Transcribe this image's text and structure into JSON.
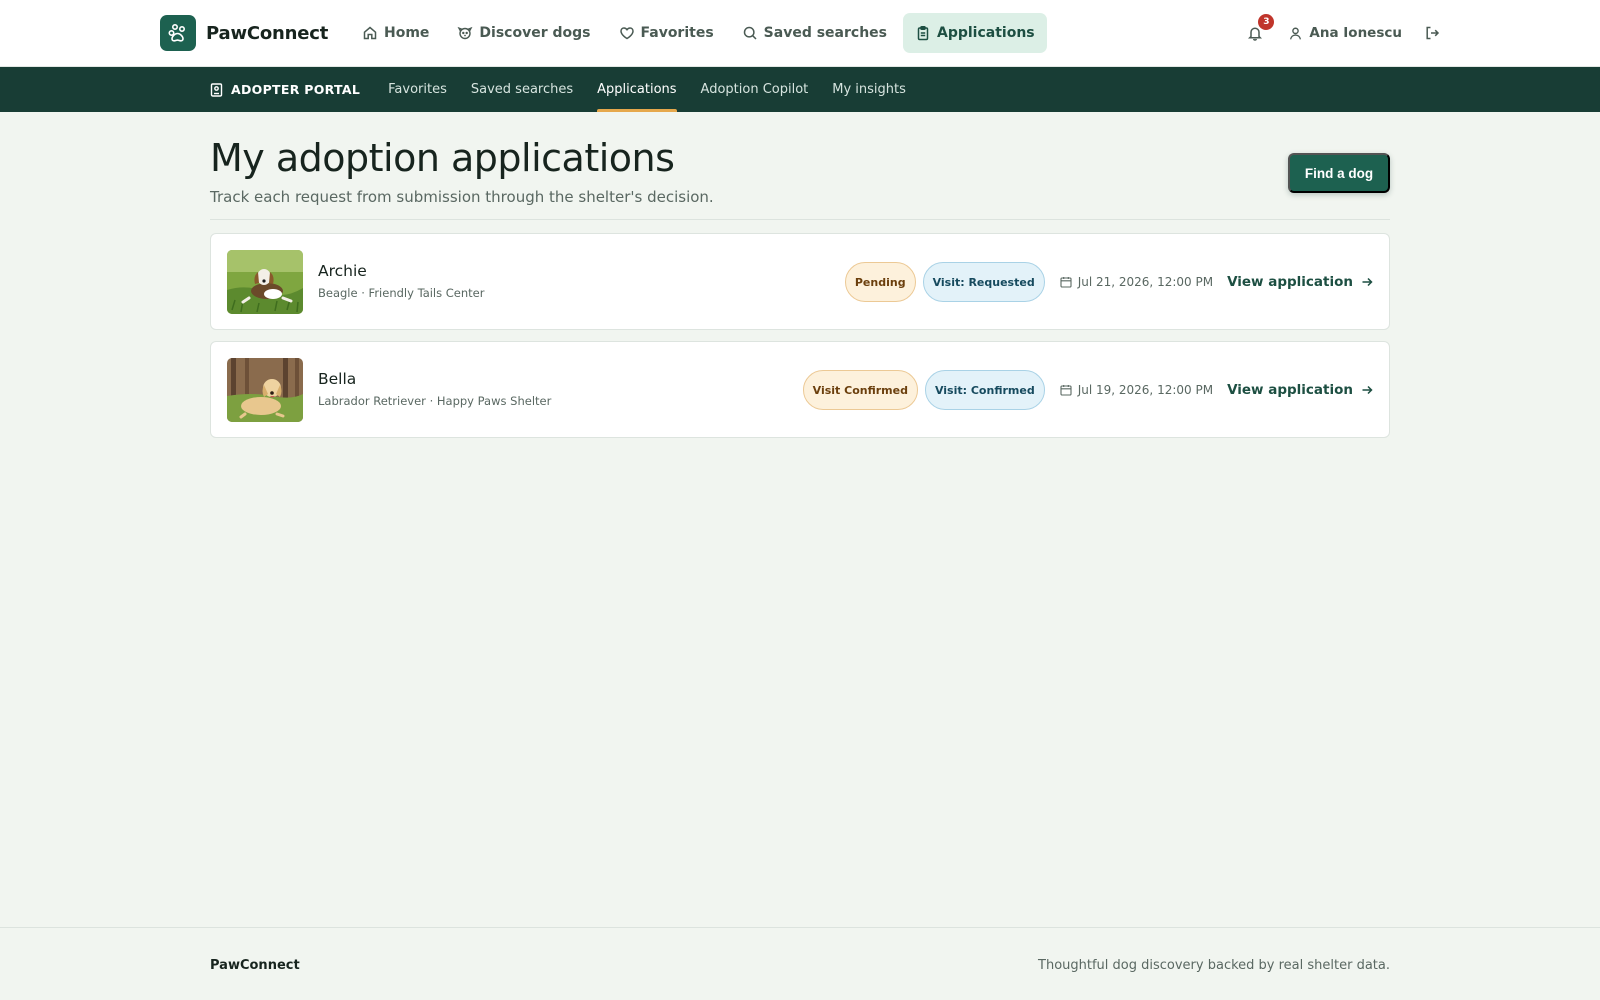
{
  "brand": {
    "name": "PawConnect",
    "accent": "#1d6150",
    "dark": "#183d35"
  },
  "topnav": {
    "links": [
      {
        "label": "Home",
        "icon": "home-icon"
      },
      {
        "label": "Discover dogs",
        "icon": "dog-icon"
      },
      {
        "label": "Favorites",
        "icon": "heart-icon"
      },
      {
        "label": "Saved searches",
        "icon": "search-icon"
      },
      {
        "label": "Applications",
        "icon": "clipboard-icon",
        "active": true
      }
    ],
    "notifications_count": "3",
    "user_name": "Ana Ionescu"
  },
  "subnav": {
    "title": "ADOPTER PORTAL",
    "links": [
      {
        "label": "Favorites"
      },
      {
        "label": "Saved searches"
      },
      {
        "label": "Applications",
        "active": true
      },
      {
        "label": "Adoption Copilot"
      },
      {
        "label": "My insights"
      }
    ]
  },
  "header": {
    "title": "My adoption applications",
    "subtitle": "Track each request from submission through the shelter's decision.",
    "find_button": "Find a dog"
  },
  "applications": [
    {
      "name": "Archie",
      "meta": "Beagle · Friendly Tails Center",
      "status": "Pending",
      "visit": "Visit: Requested",
      "date": "Jul 21, 2026, 12:00 PM",
      "link": "View application"
    },
    {
      "name": "Bella",
      "meta": "Labrador Retriever · Happy Paws Shelter",
      "status": "Visit Confirmed",
      "visit": "Visit: Confirmed",
      "date": "Jul 19, 2026, 12:00 PM",
      "link": "View application"
    }
  ],
  "footer": {
    "brand": "PawConnect",
    "tagline": "Thoughtful dog discovery backed by real shelter data."
  }
}
